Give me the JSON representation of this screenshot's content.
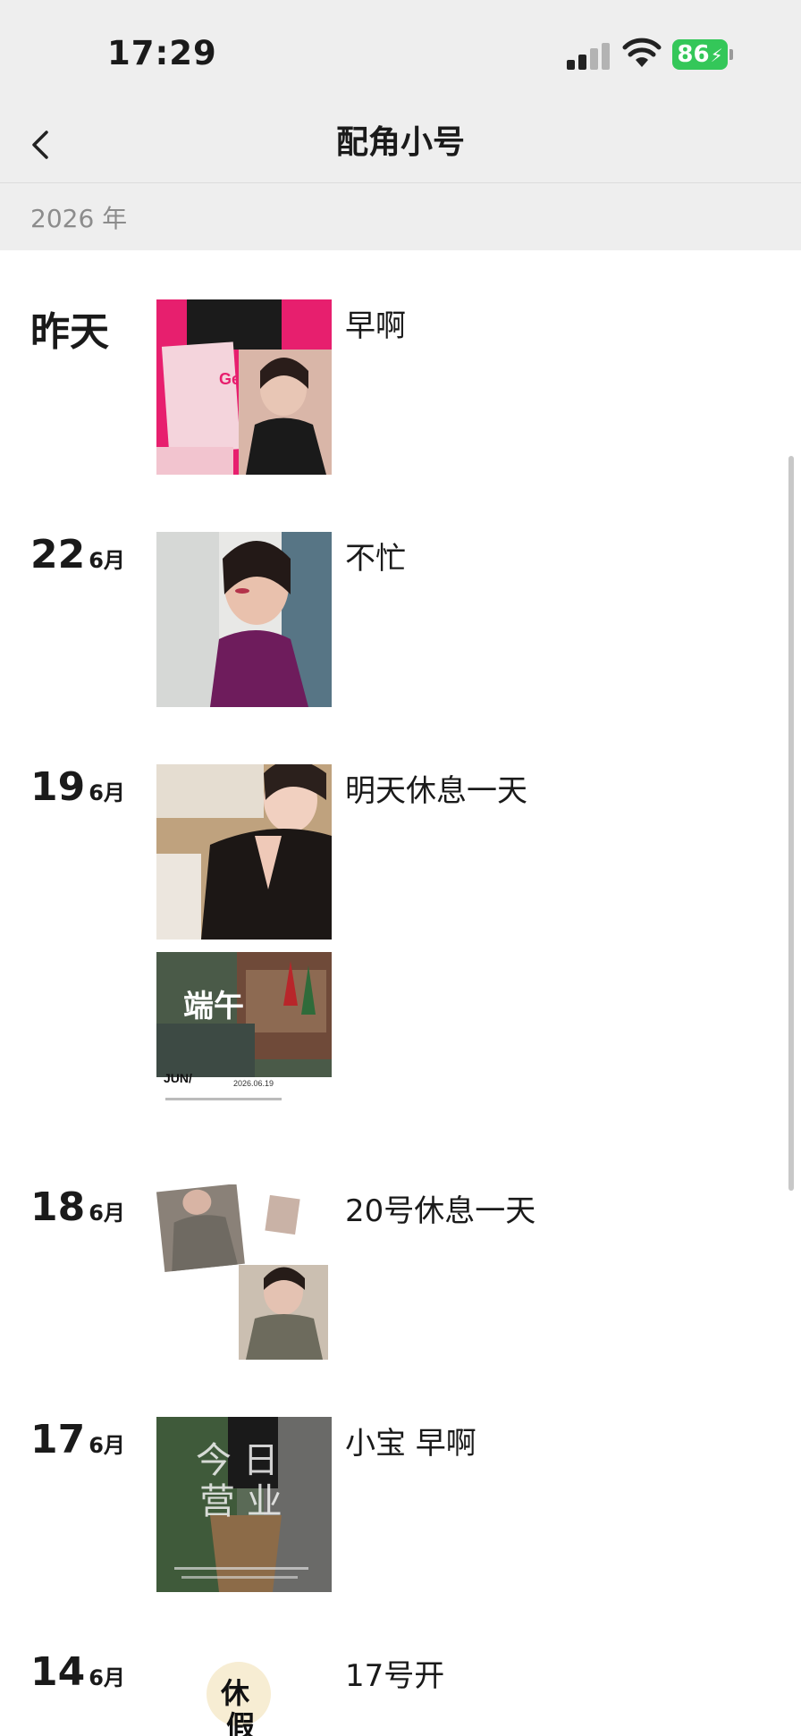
{
  "status_bar": {
    "time": "17:29",
    "battery": "86",
    "battery_color": "#34c759"
  },
  "nav": {
    "title": "配角小号",
    "back_icon": "chevron-left-icon"
  },
  "year_header": "2026 年",
  "posts": [
    {
      "date_word": "昨天",
      "caption": "早啊",
      "image": "photo-collage"
    },
    {
      "day": "22",
      "month": "6月",
      "caption": "不忙",
      "image": "portrait-photo"
    },
    {
      "day": "19",
      "month": "6月",
      "caption": "明天休息一天",
      "images": [
        "portrait-photo",
        "dragon-boat-poster"
      ]
    },
    {
      "day": "18",
      "month": "6月",
      "caption": "20号休息一天",
      "image": "photo-collage"
    },
    {
      "day": "17",
      "month": "6月",
      "caption": "小宝 早啊",
      "image": "business-poster",
      "image_text": "今日营业"
    },
    {
      "day": "14",
      "month": "6月",
      "caption": "17号开",
      "image": "calligraphy-poster",
      "image_text": "休假"
    }
  ],
  "poster_text": {
    "duanwu": "端午",
    "jun": "JUN/",
    "date": "2026.06.19"
  }
}
